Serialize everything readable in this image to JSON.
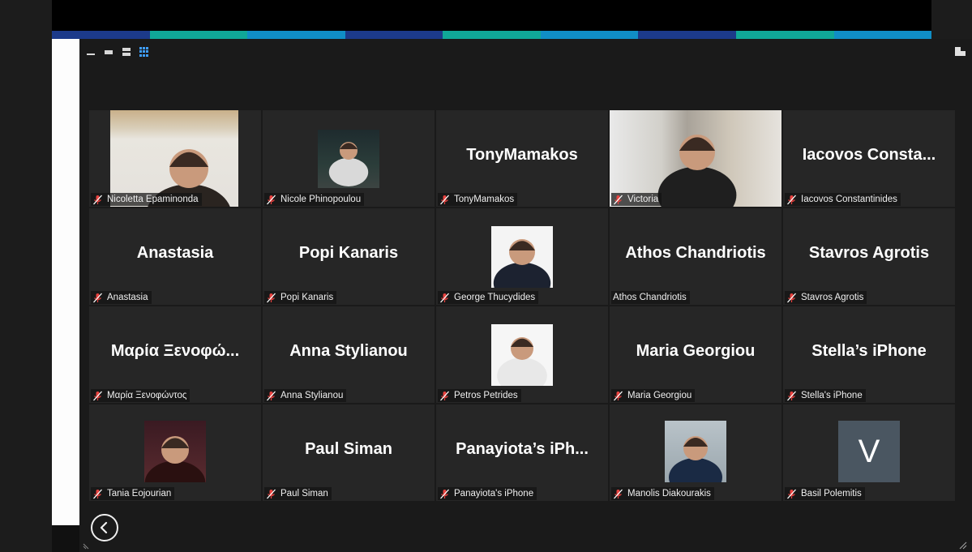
{
  "colors": {
    "stripe": [
      "#1c3a8a",
      "#10a898",
      "#108ec6",
      "#1c3a8a",
      "#10a898",
      "#108ec6",
      "#1c3a8a",
      "#10a898",
      "#108ec6"
    ],
    "tile_bg": "#262626",
    "muted_mic": "#e8423f"
  },
  "toolbar": {
    "icons": [
      "minimize-icon",
      "filmstrip-icon",
      "stack-layout-icon",
      "grid-layout-icon"
    ],
    "right_icon": "layout-toggle-icon"
  },
  "participants": [
    {
      "big": "",
      "label": "Nicoletta Epaminonda",
      "muted": true,
      "video": true
    },
    {
      "big": "",
      "label": "Nicole Phinopoulou",
      "muted": true,
      "video": true
    },
    {
      "big": "TonyMamakos",
      "label": "TonyMamakos",
      "muted": true,
      "video": false
    },
    {
      "big": "",
      "label": "Victoria",
      "muted": true,
      "video": true
    },
    {
      "big": "Iacovos  Consta...",
      "label": "Iacovos Constantinides",
      "muted": true,
      "video": false
    },
    {
      "big": "Anastasia",
      "label": "Anastasia",
      "muted": true,
      "video": false
    },
    {
      "big": "Popi Kanaris",
      "label": "Popi Kanaris",
      "muted": true,
      "video": false
    },
    {
      "big": "",
      "label": "George Thucydides",
      "muted": true,
      "video": true
    },
    {
      "big": "Athos Chandriotis",
      "label": "Athos Chandriotis",
      "muted": false,
      "video": false
    },
    {
      "big": "Stavros Agrotis",
      "label": "Stavros Agrotis",
      "muted": true,
      "video": false
    },
    {
      "big": "Μαρία Ξενοφώ...",
      "label": "Μαρία Ξενοφώντος",
      "muted": true,
      "video": false
    },
    {
      "big": "Anna Stylianou",
      "label": "Anna Stylianou",
      "muted": true,
      "video": false
    },
    {
      "big": "",
      "label": "Petros Petrides",
      "muted": true,
      "video": true
    },
    {
      "big": "Maria Georgiou",
      "label": "Maria Georgiou",
      "muted": true,
      "video": false
    },
    {
      "big": "Stella’s iPhone",
      "label": "Stella's iPhone",
      "muted": true,
      "video": false
    },
    {
      "big": "",
      "label": "Tania Eojourian",
      "muted": true,
      "video": true
    },
    {
      "big": "Paul Siman",
      "label": "Paul Siman",
      "muted": true,
      "video": false
    },
    {
      "big": "Panayiota’s  iPh...",
      "label": "Panayiota's iPhone",
      "muted": true,
      "video": false
    },
    {
      "big": "",
      "label": "Manolis Diakourakis",
      "muted": true,
      "video": true
    },
    {
      "big": "",
      "label": "Basil Polemitis",
      "muted": true,
      "video": false,
      "avatar_letter": "V"
    }
  ]
}
